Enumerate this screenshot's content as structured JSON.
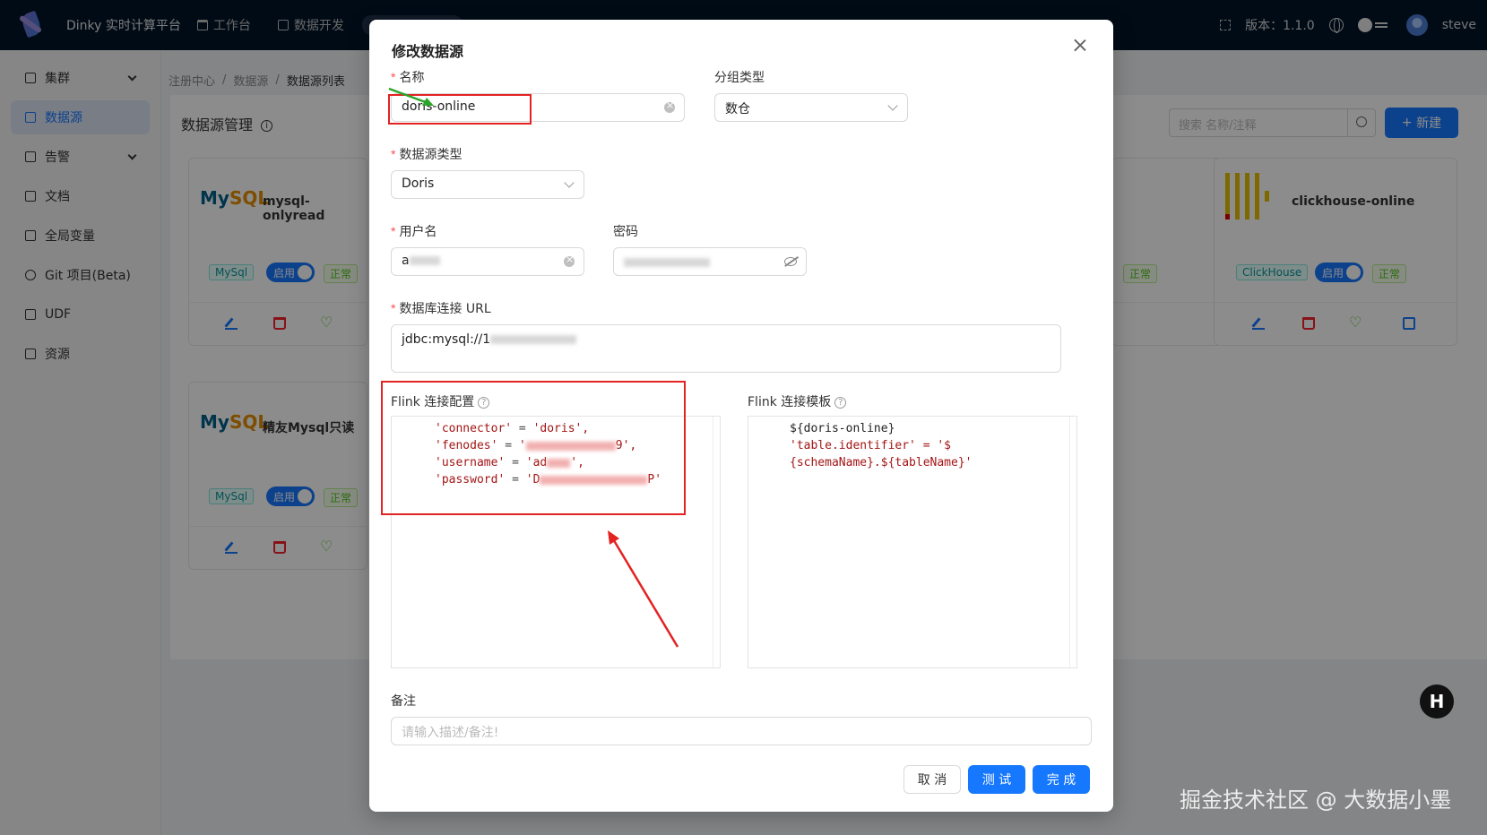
{
  "topbar": {
    "app_title": "Dinky 实时计算平台",
    "nav": [
      "工作台",
      "数据开发"
    ],
    "version": "版本：1.1.0",
    "user": "steve"
  },
  "sidebar": {
    "items": [
      {
        "label": "集群",
        "expandable": true
      },
      {
        "label": "数据源",
        "active": true
      },
      {
        "label": "告警",
        "expandable": true
      },
      {
        "label": "文档"
      },
      {
        "label": "全局变量"
      },
      {
        "label": "Git 项目(Beta)"
      },
      {
        "label": "UDF"
      },
      {
        "label": "资源"
      }
    ]
  },
  "breadcrumb": [
    "注册中心",
    "数据源",
    "数据源列表"
  ],
  "list_page": {
    "title": "数据源管理",
    "search_placeholder": "搜索 名称/注释",
    "new_button": "新建",
    "cards": [
      {
        "name": "mysql-onlyread",
        "type": "MySql",
        "switch": "启用",
        "status": "正常"
      },
      {
        "name": "精友Mysql只读",
        "type": "MySql",
        "switch": "启用",
        "status": "正常"
      },
      {
        "name": "clickhouse-online",
        "type": "ClickHouse",
        "switch": "启用",
        "status": "正常"
      },
      {
        "status": "正常"
      }
    ]
  },
  "modal": {
    "title": "修改数据源",
    "name_label": "名称",
    "name_value": "doris-online",
    "group_label": "分组类型",
    "group_value": "数仓",
    "type_label": "数据源类型",
    "type_value": "Doris",
    "username_label": "用户名",
    "username_value": "a",
    "password_label": "密码",
    "url_label": "数据库连接 URL",
    "url_value": "jdbc:mysql://1",
    "flink_config_label": "Flink 连接配置",
    "flink_config_lines": [
      {
        "key": "'connector'",
        "op": " = ",
        "val": "'doris',"
      },
      {
        "key": "'fenodes'",
        "op": " = ",
        "val": "'",
        "tail": "9',"
      },
      {
        "key": "'username'",
        "op": " = ",
        "val": "'ad",
        "tail": "',"
      },
      {
        "key": "'password'",
        "op": " = ",
        "val": "'D",
        "tail": "P'"
      }
    ],
    "flink_template_label": "Flink 连接模板",
    "flink_template_lines": [
      "${doris-online}",
      "'table.identifier' = '$",
      "{schemaName}.${tableName}'"
    ],
    "remark_label": "备注",
    "remark_placeholder": "请输入描述/备注!",
    "cancel": "取 消",
    "test": "测 试",
    "done": "完 成"
  },
  "watermark": "掘金技术社区 @ 大数据小墨",
  "badge": "H",
  "colors": {
    "primary": "#1677ff",
    "annotation": "#e32222",
    "arrow_green": "#2aa52a"
  }
}
